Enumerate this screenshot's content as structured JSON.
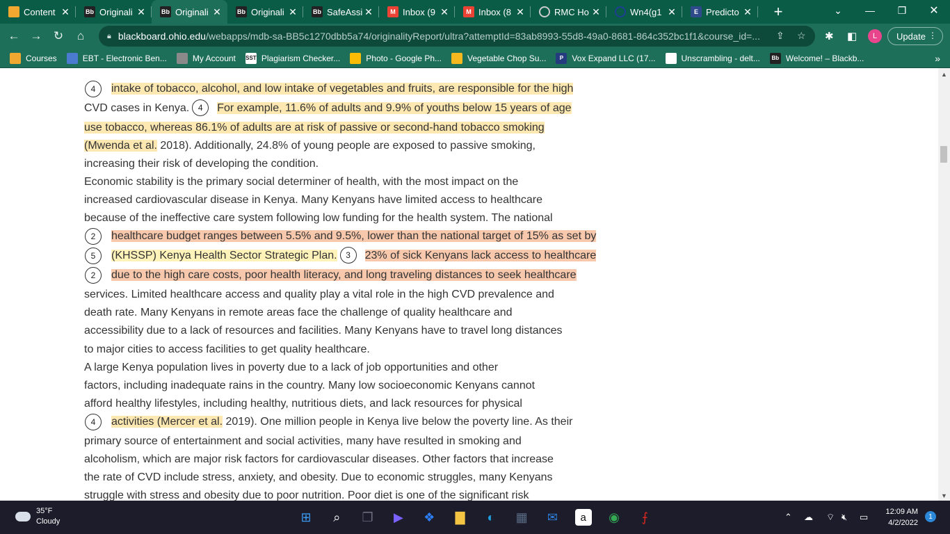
{
  "tabs": [
    {
      "title": "Content",
      "icon": "pencil-icon",
      "icon_color": "#f0a830",
      "icon_text": "",
      "active": false
    },
    {
      "title": "Originali",
      "icon": "blackboard-icon",
      "icon_color": "#222222",
      "icon_text": "Bb",
      "active": false
    },
    {
      "title": "Originali",
      "icon": "blackboard-icon",
      "icon_color": "#222222",
      "icon_text": "Bb",
      "active": true
    },
    {
      "title": "Originali",
      "icon": "blackboard-icon",
      "icon_color": "#222222",
      "icon_text": "Bb",
      "active": false
    },
    {
      "title": "SafeAssi",
      "icon": "blackboard-icon",
      "icon_color": "#222222",
      "icon_text": "Bb",
      "active": false
    },
    {
      "title": "Inbox (9",
      "icon": "gmail-icon",
      "icon_color": "#ea4335",
      "icon_text": "M",
      "active": false
    },
    {
      "title": "Inbox (8",
      "icon": "gmail-icon",
      "icon_color": "#ea4335",
      "icon_text": "M",
      "active": false
    },
    {
      "title": "RMC Ho",
      "icon": "loading-icon",
      "icon_color": "#cccccc",
      "icon_text": "",
      "active": false
    },
    {
      "title": "Wn4(g1",
      "icon": "circle-app-icon",
      "icon_color": "#1d3f8f",
      "icon_text": "",
      "active": false
    },
    {
      "title": "Predicto",
      "icon": "letter-e-icon",
      "icon_color": "#2f4a8a",
      "icon_text": "E",
      "active": false
    }
  ],
  "toolbar": {
    "url_domain": "blackboard.ohio.edu",
    "url_path": "/webapps/mdb-sa-BB5c1270dbb5a74/originalityReport/ultra?attemptId=83ab8993-55d8-49a0-8681-864c352bc1f1&course_id=...",
    "profile_initial": "L",
    "update_label": "Update"
  },
  "bookmarks": [
    {
      "label": "Courses",
      "icon": "pencil-icon",
      "color": "#f0a830",
      "text": ""
    },
    {
      "label": "EBT - Electronic Ben...",
      "icon": "ebt-icon",
      "color": "#4a7bd1",
      "text": ""
    },
    {
      "label": "My Account",
      "icon": "account-icon",
      "color": "#8a8a8a",
      "text": ""
    },
    {
      "label": "Plagiarism Checker...",
      "icon": "sst-icon",
      "color": "#ffffff",
      "text": "SST"
    },
    {
      "label": "Photo - Google Ph...",
      "icon": "google-photos-icon",
      "color": "#fbbc05",
      "text": ""
    },
    {
      "label": "Vegetable Chop Su...",
      "icon": "heart-icon",
      "color": "#f6b81e",
      "text": ""
    },
    {
      "label": "Vox Expand LLC (17...",
      "icon": "paypal-icon",
      "color": "#253b80",
      "text": "P"
    },
    {
      "label": "Unscrambling - delt...",
      "icon": "globe-icon",
      "color": "#ffffff",
      "text": ""
    },
    {
      "label": "Welcome! – Blackb...",
      "icon": "blackboard-icon",
      "color": "#222222",
      "text": "Bb"
    }
  ],
  "doc": {
    "l1": "intake of tobacco, alcohol, and low intake of vegetables and fruits, are responsible for the high",
    "l2a": "CVD cases in Kenya.",
    "l2b": "For example, 11.6% of adults and 9.9% of youths below 15 years of age",
    "l3": "use tobacco, whereas 86.1% of adults are at risk of passive or second-hand tobacco smoking",
    "l4a": "(Mwenda et al.",
    "l4b": " 2018). Additionally, 24.8% of young people are exposed to passive smoking,",
    "l5": "increasing their risk of developing the condition.",
    "l6": "Economic stability is the primary social determiner of health, with the most impact on the",
    "l7": "increased cardiovascular disease in Kenya. Many Kenyans have limited access to healthcare",
    "l8": "because of the ineffective care system following low funding for the health system. The national",
    "l9": "healthcare budget ranges between 5.5% and 9.5%, lower than the national target of 15% as set by",
    "l10a": "(KHSSP) Kenya Health Sector Strategic Plan.",
    "l10b": "23% of sick Kenyans lack access to healthcare",
    "l11": "due to the high care costs, poor health literacy, and long traveling distances to seek healthcare",
    "l12": "services. Limited healthcare access and quality play a vital role in the high CVD prevalence and",
    "l13": "death rate. Many Kenyans in remote areas face the challenge of quality healthcare and",
    "l14": "accessibility due to a lack of resources and facilities. Many Kenyans have to travel long distances",
    "l15": "to major cities to access facilities to get quality healthcare.",
    "l16": "A large Kenya population lives in poverty due to a lack of job opportunities and other",
    "l17": "factors, including inadequate rains in the country. Many low socioeconomic Kenyans cannot",
    "l18": "afford healthy lifestyles, including healthy, nutritious diets, and lack resources for physical",
    "l19a": "activities (Mercer et al.",
    "l19b": " 2019). One million people in Kenya live below the poverty line. As their",
    "l20": "primary source of entertainment and social activities, many have resulted in smoking and",
    "l21": "alcoholism, which are major risk factors for cardiovascular diseases. Other factors that increase",
    "l22": "the rate of CVD include stress, anxiety, and obesity. Due to economic struggles, many Kenyans",
    "l23": "struggle with stress and obesity due to poor nutrition. Poor diet is one of the significant risk",
    "markers": {
      "m1": "4",
      "m2": "4",
      "m3": "2",
      "m4": "5",
      "m5": "3",
      "m6": "2",
      "m7": "4"
    }
  },
  "taskbar": {
    "temp": "35°F",
    "condition": "Cloudy",
    "time": "12:09 AM",
    "date": "4/2/2022",
    "notifications": "1",
    "tray_hidden_icons": "chevron-up-icon",
    "apps": [
      "windows-start-icon",
      "search-icon",
      "task-view-icon",
      "chat-icon",
      "dropbox-icon",
      "file-explorer-icon",
      "edge-icon",
      "store-icon",
      "mail-icon",
      "amazon-icon",
      "chrome-icon",
      "acrobat-icon"
    ]
  }
}
